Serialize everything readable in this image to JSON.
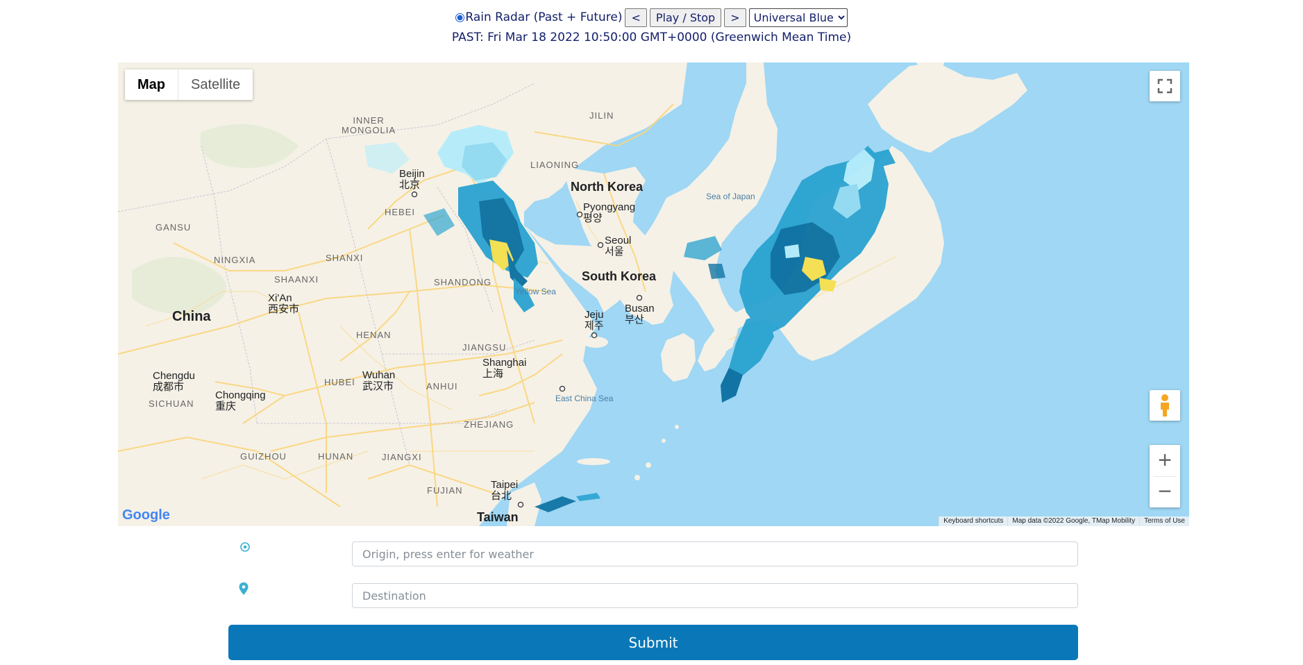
{
  "controls": {
    "radio_label": "Rain Radar (Past + Future)",
    "prev_label": "<",
    "play_label": "Play / Stop",
    "next_label": ">",
    "color_scheme_selected": "Universal Blue"
  },
  "timestamp": "PAST: Fri Mar 18 2022 10:50:00 GMT+0000 (Greenwich Mean Time)",
  "map": {
    "type_buttons": {
      "map": "Map",
      "satellite": "Satellite"
    },
    "labels": {
      "china": "China",
      "north_korea": "North Korea",
      "south_korea": "South Korea",
      "taiwan": "Taiwan",
      "inner_mongolia": "INNER\nMONGOLIA",
      "jilin": "JILIN",
      "liaoning": "LIAONING",
      "hebei": "HEBEI",
      "gansu": "GANSU",
      "ningxia": "NINGXIA",
      "shanxi": "SHANXI",
      "shaanxi": "SHAANXI",
      "shandong": "SHANDONG",
      "henan": "HENAN",
      "jiangsu": "JIANGSU",
      "hubei": "HUBEI",
      "anhui": "ANHUI",
      "sichuan": "SICHUAN",
      "zhejiang": "ZHEJIANG",
      "guizhou": "GUIZHOU",
      "hunan": "HUNAN",
      "jiangxi": "JIANGXI",
      "fujian": "FUJIAN",
      "beijing": "Beijin\n北京",
      "pyongyang": "Pyongyang\n평양",
      "seoul": "Seoul\n서울",
      "xian": "Xi'An\n西安市",
      "busan": "Busan\n부산",
      "jeju": "Jeju\n제주",
      "shanghai": "Shanghai\n上海",
      "wuhan": "Wuhan\n武汉市",
      "chengdu": "Chengdu\n成都市",
      "chongqing": "Chongqing\n重庆",
      "taipei": "Taipei\n台北",
      "sea_of_japan": "Sea of Japan",
      "yellow_sea": "Yellow Sea",
      "east_china_sea": "East China Sea"
    },
    "logo": "Google",
    "attribution": {
      "shortcuts": "Keyboard shortcuts",
      "data": "Map data ©2022 Google, TMap Mobility",
      "terms": "Terms of Use"
    },
    "zoom_in": "+",
    "zoom_out": "−"
  },
  "form": {
    "origin_placeholder": "Origin, press enter for weather",
    "destination_placeholder": "Destination",
    "submit_label": "Submit"
  },
  "colors": {
    "water": "#9fd7f4",
    "land": "#f5f1e6",
    "roads": "#fbd57a",
    "radar_light": "#b3ecfb",
    "radar_mid": "#2aa3d0",
    "radar_dark": "#0a6fa0",
    "radar_heavy": "#f4e04d",
    "submit": "#0a78b8",
    "text": "#14206b"
  },
  "icons": {
    "origin": "origin-target-icon",
    "destination": "destination-pin-icon",
    "fullscreen": "fullscreen-icon",
    "pegman": "pegman-icon"
  }
}
